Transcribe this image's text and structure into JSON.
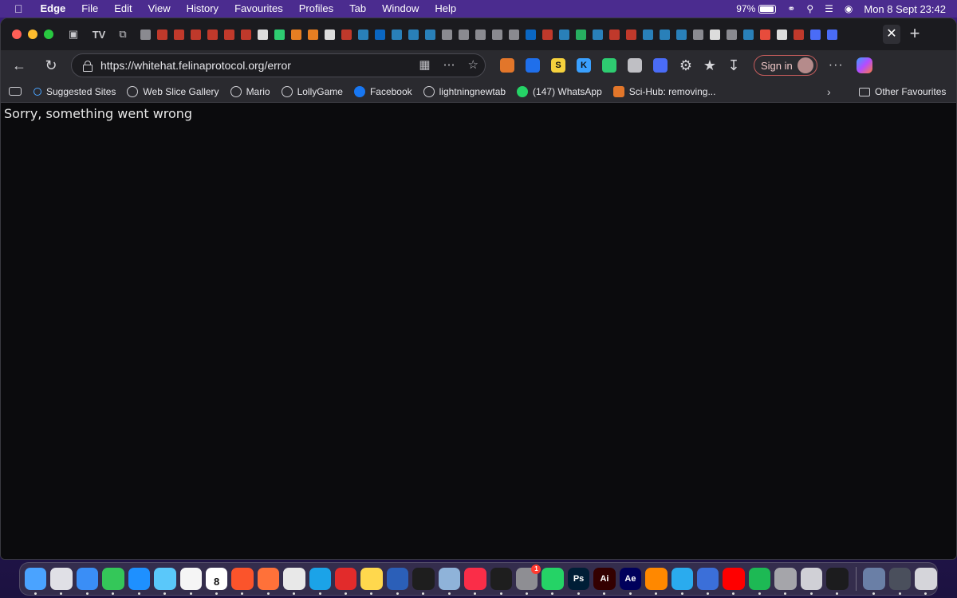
{
  "menubar": {
    "app": "Edge",
    "items": [
      "File",
      "Edit",
      "View",
      "History",
      "Favourites",
      "Profiles",
      "Tab",
      "Window",
      "Help"
    ],
    "battery": "97%",
    "clock": "Mon 8 Sept  23:42"
  },
  "tabs": {
    "favicon_colors": [
      "#8a8a90",
      "#c0392b",
      "#c0392b",
      "#c0392b",
      "#c0392b",
      "#c0392b",
      "#c0392b",
      "#dcdcdc",
      "#2ecc71",
      "#e67e22",
      "#e67e22",
      "#dcdcdc",
      "#c0392b",
      "#2980b9",
      "#0a66c2",
      "#2980b9",
      "#2980b9",
      "#2980b9",
      "#8a8a90",
      "#8a8a90",
      "#8a8a90",
      "#8a8a90",
      "#8a8a90",
      "#0a66c2",
      "#c0392b",
      "#2980b9",
      "#27ae60",
      "#2980b9",
      "#c0392b",
      "#c0392b",
      "#2980b9",
      "#2980b9",
      "#2980b9",
      "#8a8a90",
      "#dcdcdc",
      "#8a8a90",
      "#2980b9",
      "#e74c3c",
      "#dcdcdc",
      "#c0392b",
      "#4a6cf7",
      "#4a6cf7"
    ],
    "close_label": "✕",
    "new_tab_label": "+"
  },
  "toolbar": {
    "url": "https://whitehat.felinaprotocol.org/error",
    "sign_in_label": "Sign in",
    "more_label": "···",
    "extensions": [
      {
        "name": "fox-extension-icon",
        "color": "#e2762a",
        "glyph": ""
      },
      {
        "name": "shield-extension-icon",
        "color": "#1f6feb",
        "glyph": ""
      },
      {
        "name": "s-extension-icon",
        "color": "#f5d13d",
        "glyph": "S"
      },
      {
        "name": "k-extension-icon",
        "color": "#3aa0ff",
        "glyph": "K"
      },
      {
        "name": "robot-extension-icon",
        "color": "#2ecc71",
        "glyph": ""
      },
      {
        "name": "camera-extension-icon",
        "color": "#bfbfc4",
        "glyph": ""
      },
      {
        "name": "bird-extension-icon",
        "color": "#4a6cf7",
        "glyph": ""
      }
    ]
  },
  "favourites": {
    "items": [
      {
        "label": "Suggested Sites",
        "icon": "search"
      },
      {
        "label": "Web Slice Gallery",
        "icon": "globe"
      },
      {
        "label": "Mario",
        "icon": "globe"
      },
      {
        "label": "LollyGame",
        "icon": "globe"
      },
      {
        "label": "Facebook",
        "icon": "facebook"
      },
      {
        "label": "lightningnewtab",
        "icon": "globe"
      },
      {
        "label": "(147) WhatsApp",
        "icon": "whatsapp"
      },
      {
        "label": "Sci-Hub: removing...",
        "icon": "scihub"
      }
    ],
    "other_label": "Other Favourites"
  },
  "page": {
    "error_message": "Sorry, something went wrong"
  },
  "dock": {
    "apps": [
      {
        "name": "finder",
        "color": "#4aa3ff"
      },
      {
        "name": "launchpad",
        "color": "#e0e0e6"
      },
      {
        "name": "safari",
        "color": "#3a8ef6"
      },
      {
        "name": "facetime",
        "color": "#34c759"
      },
      {
        "name": "app-store",
        "color": "#1e90ff"
      },
      {
        "name": "maps",
        "color": "#5ac8fa"
      },
      {
        "name": "photos",
        "color": "#f5f5f5"
      },
      {
        "name": "calendar",
        "color": "#ffffff",
        "day": "8"
      },
      {
        "name": "brave",
        "color": "#fb542b"
      },
      {
        "name": "firefox",
        "color": "#ff7139"
      },
      {
        "name": "chrome",
        "color": "#e8e8e8"
      },
      {
        "name": "edge",
        "color": "#1ba3e8"
      },
      {
        "name": "acrobat",
        "color": "#e22b2b"
      },
      {
        "name": "notes",
        "color": "#ffd84d"
      },
      {
        "name": "word",
        "color": "#2b5fb8"
      },
      {
        "name": "figma",
        "color": "#1e1e1e"
      },
      {
        "name": "preview",
        "color": "#8fb3d9"
      },
      {
        "name": "music",
        "color": "#fa2d48"
      },
      {
        "name": "tradingview",
        "color": "#1e1e1e"
      },
      {
        "name": "system-settings",
        "color": "#8e8e93",
        "badge": "1"
      },
      {
        "name": "whatsapp",
        "color": "#25d366"
      },
      {
        "name": "photoshop",
        "color": "#001e36",
        "label": "Ps"
      },
      {
        "name": "illustrator",
        "color": "#330000",
        "label": "Ai"
      },
      {
        "name": "after-effects",
        "color": "#00005b",
        "label": "Ae"
      },
      {
        "name": "vlc",
        "color": "#ff8800"
      },
      {
        "name": "telegram",
        "color": "#2aabee"
      },
      {
        "name": "quicktime",
        "color": "#3b6fd9"
      },
      {
        "name": "youtube-music",
        "color": "#ff0000"
      },
      {
        "name": "spotify",
        "color": "#1db954"
      },
      {
        "name": "calculator",
        "color": "#a5a5aa"
      },
      {
        "name": "installer",
        "color": "#d0d0d6"
      },
      {
        "name": "terminal",
        "color": "#1c1c1e"
      }
    ],
    "trailing": [
      {
        "name": "downloads-stack",
        "color": "#6a7fa6"
      },
      {
        "name": "screenshots-stack",
        "color": "#4a4f5c"
      },
      {
        "name": "trash",
        "color": "#d5d5da"
      }
    ]
  }
}
